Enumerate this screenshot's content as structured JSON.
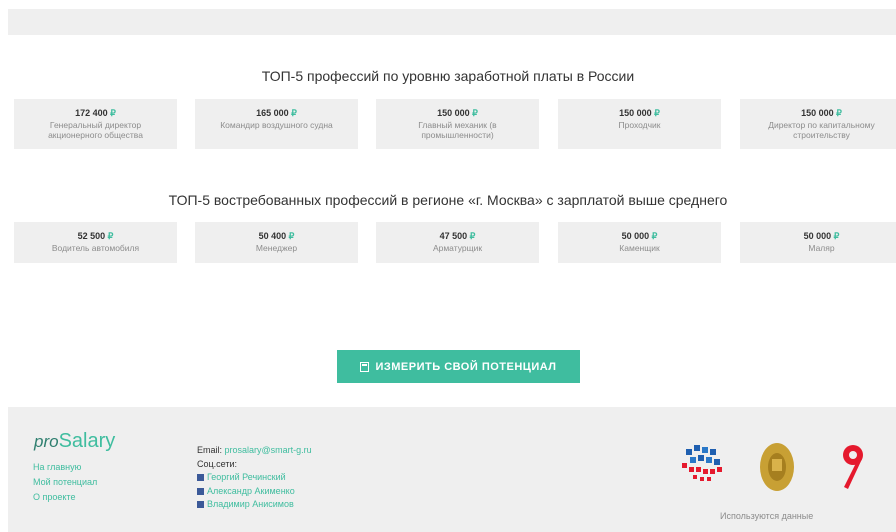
{
  "top5_russia": {
    "title": "ТОП-5 профессий по уровню заработной платы в России",
    "items": [
      {
        "value": "172 400",
        "name": "Генеральный директор акционерного общества"
      },
      {
        "value": "165 000",
        "name": "Командир воздушного судна"
      },
      {
        "value": "150 000",
        "name": "Главный механик (в промышленности)"
      },
      {
        "value": "150 000",
        "name": "Проходчик"
      },
      {
        "value": "150 000",
        "name": "Директор по капитальному строительству"
      }
    ]
  },
  "top5_region": {
    "title": "ТОП-5 востребованных профессий в регионе «г. Москва» с зарплатой выше среднего",
    "items": [
      {
        "value": "52 500",
        "name": "Водитель автомобиля"
      },
      {
        "value": "50 400",
        "name": "Менеджер"
      },
      {
        "value": "47 500",
        "name": "Арматурщик"
      },
      {
        "value": "50 000",
        "name": "Каменщик"
      },
      {
        "value": "50 000",
        "name": "Маляр"
      }
    ]
  },
  "currency_symbol": "₽",
  "cta": {
    "label": "ИЗМЕРИТЬ СВОЙ ПОТЕНЦИАЛ",
    "icon": "calculator-icon"
  },
  "footer": {
    "logo": {
      "prefix": "pro",
      "main": "Salary"
    },
    "links": [
      "На главную",
      "Мой потенциал",
      "О проекте"
    ],
    "email_label": "Email: ",
    "email": "prosalary@smart-g.ru",
    "social_label": "Соц.сети:",
    "people": [
      "Георгий Речинский",
      "Александр Акименко",
      "Владимир Анисимов"
    ],
    "note": "Используются данные"
  },
  "colors": {
    "accent": "#3fbd9f",
    "panel": "#efefef",
    "facebook": "#3b5998",
    "brand_red": "#e5192d"
  }
}
